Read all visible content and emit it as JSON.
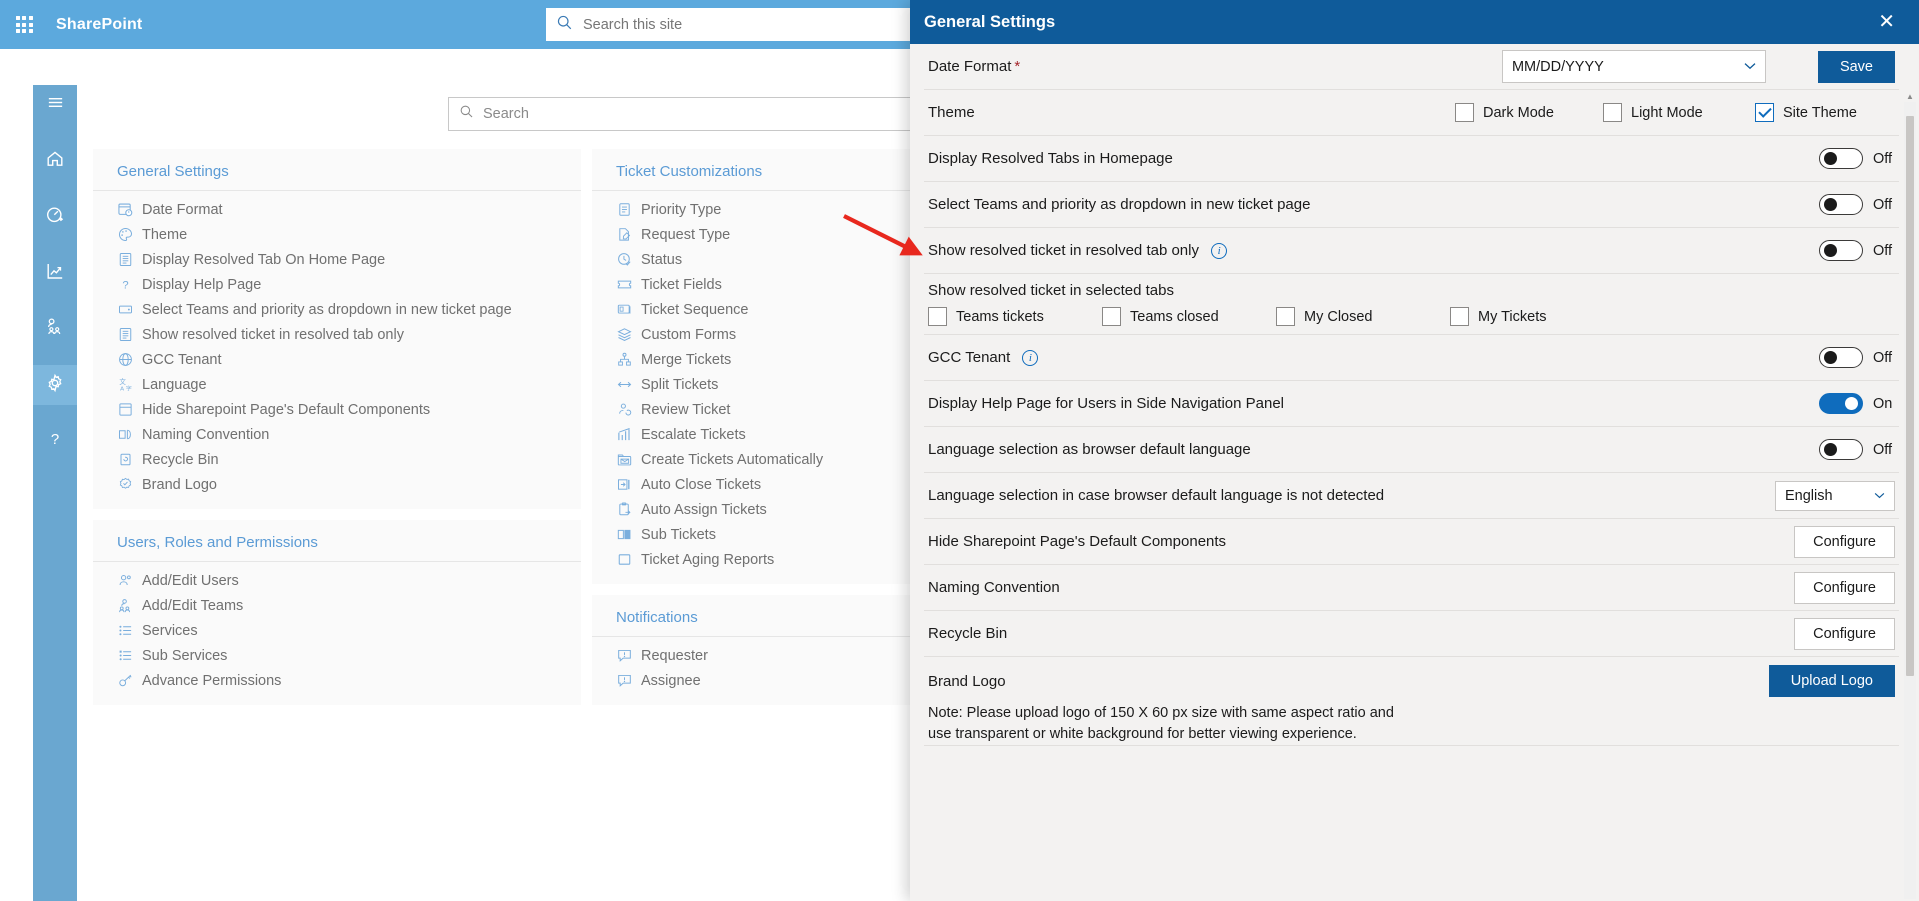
{
  "suite": {
    "title": "SharePoint",
    "waffle_icon": "app-launcher-icon",
    "search_placeholder": "Search this site",
    "search_value": "",
    "search_icon": "search-icon"
  },
  "app": {
    "search_placeholder": "Search",
    "search_value": "",
    "search_icon": "search-icon"
  },
  "rail": {
    "items": [
      {
        "name": "hamburger-menu",
        "icon": "hamburger-icon",
        "active": false
      },
      {
        "name": "home",
        "icon": "home-icon",
        "active": false
      },
      {
        "name": "dashboard",
        "icon": "gauge-icon",
        "active": false
      },
      {
        "name": "reports",
        "icon": "chart-line-icon",
        "active": false
      },
      {
        "name": "teams",
        "icon": "people-team-icon",
        "active": false
      },
      {
        "name": "settings",
        "icon": "gear-icon",
        "active": true
      },
      {
        "name": "help",
        "icon": "question-icon",
        "active": false
      }
    ]
  },
  "cards": [
    {
      "id": "general-settings",
      "title": "General Settings",
      "items": [
        {
          "label": "Date Format",
          "icon": "calendar-clock-icon"
        },
        {
          "label": "Theme",
          "icon": "palette-icon"
        },
        {
          "label": "Display Resolved Tab On Home Page",
          "icon": "list-icon"
        },
        {
          "label": "Display Help Page",
          "icon": "question-icon"
        },
        {
          "label": "Select Teams and priority as dropdown in new ticket page",
          "icon": "dropdown-icon"
        },
        {
          "label": "Show resolved ticket in resolved tab only",
          "icon": "list-icon"
        },
        {
          "label": "GCC Tenant",
          "icon": "globe-icon"
        },
        {
          "label": "Language",
          "icon": "translate-icon"
        },
        {
          "label": "Hide Sharepoint Page's Default Components",
          "icon": "page-icon"
        },
        {
          "label": "Naming Convention",
          "icon": "rename-icon"
        },
        {
          "label": "Recycle Bin",
          "icon": "recycle-bin-icon"
        },
        {
          "label": "Brand Logo",
          "icon": "badge-icon"
        }
      ]
    },
    {
      "id": "users-roles-permissions",
      "title": "Users, Roles and Permissions",
      "items": [
        {
          "label": "Add/Edit Users",
          "icon": "people-icon"
        },
        {
          "label": "Add/Edit Teams",
          "icon": "people-team-icon"
        },
        {
          "label": "Services",
          "icon": "bullet-list-icon"
        },
        {
          "label": "Sub Services",
          "icon": "sub-list-icon"
        },
        {
          "label": "Advance Permissions",
          "icon": "key-icon"
        }
      ]
    },
    {
      "id": "ticket-customizations",
      "title": "Ticket Customizations",
      "items": [
        {
          "label": "Priority Type",
          "icon": "clipboard-check-icon"
        },
        {
          "label": "Request Type",
          "icon": "document-edit-icon"
        },
        {
          "label": "Status",
          "icon": "clock-check-icon"
        },
        {
          "label": "Ticket Fields",
          "icon": "ticket-icon"
        },
        {
          "label": "Ticket Sequence",
          "icon": "number-sequence-icon"
        },
        {
          "label": "Custom Forms",
          "icon": "layers-icon"
        },
        {
          "label": "Merge Tickets",
          "icon": "merge-icon"
        },
        {
          "label": "Split Tickets",
          "icon": "split-arrows-icon"
        },
        {
          "label": "Review Ticket",
          "icon": "person-sync-icon"
        },
        {
          "label": "Escalate Tickets",
          "icon": "chart-up-icon"
        },
        {
          "label": "Create Tickets Automatically",
          "icon": "mail-folder-icon"
        },
        {
          "label": "Auto Close Tickets",
          "icon": "arrow-box-icon"
        },
        {
          "label": "Auto Assign Tickets",
          "icon": "clipboard-arrow-icon"
        },
        {
          "label": "Sub Tickets",
          "icon": "columns-icon"
        },
        {
          "label": "Ticket Aging Reports",
          "icon": "square-icon"
        }
      ]
    },
    {
      "id": "notifications",
      "title": "Notifications",
      "items": [
        {
          "label": "Requester",
          "icon": "comment-alert-icon"
        },
        {
          "label": "Assignee",
          "icon": "comment-alert-icon"
        }
      ]
    }
  ],
  "panel": {
    "title": "General Settings",
    "close_label": "✕",
    "save_label": "Save",
    "scrollbar_up": "▲",
    "rows": {
      "date_format": {
        "label": "Date Format",
        "required_marker": "*",
        "value": "MM/DD/YYYY",
        "chevron": "⌄"
      },
      "theme": {
        "label": "Theme",
        "options": [
          {
            "label": "Dark Mode",
            "checked": false
          },
          {
            "label": "Light Mode",
            "checked": false
          },
          {
            "label": "Site Theme",
            "checked": true
          }
        ]
      },
      "display_resolved_tabs": {
        "label": "Display Resolved Tabs in Homepage",
        "state": "Off",
        "on": false
      },
      "select_teams_priority": {
        "label": "Select Teams and priority as dropdown in new ticket page",
        "state": "Off",
        "on": false
      },
      "show_resolved_only": {
        "label": "Show resolved ticket in resolved tab only",
        "info_icon": "info-icon",
        "state": "Off",
        "on": false
      },
      "show_resolved_selected_tabs": {
        "label": "Show resolved ticket in selected tabs",
        "options": [
          {
            "label": "Teams tickets",
            "checked": false
          },
          {
            "label": "Teams closed",
            "checked": false
          },
          {
            "label": "My Closed",
            "checked": false
          },
          {
            "label": "My Tickets",
            "checked": false
          }
        ]
      },
      "gcc_tenant": {
        "label": "GCC Tenant",
        "info_icon": "info-icon",
        "state": "Off",
        "on": false
      },
      "display_help_page": {
        "label": "Display Help Page for Users in Side Navigation Panel",
        "state": "On",
        "on": true
      },
      "language_browser_default": {
        "label": "Language selection as browser default language",
        "state": "Off",
        "on": false
      },
      "language_fallback": {
        "label": "Language selection in case browser default language is not detected",
        "value": "English",
        "chevron": "⌄"
      },
      "hide_sp_components": {
        "label": "Hide Sharepoint Page's Default Components",
        "button": "Configure"
      },
      "naming_convention": {
        "label": "Naming Convention",
        "button": "Configure"
      },
      "recycle_bin": {
        "label": "Recycle Bin",
        "button": "Configure"
      },
      "brand_logo": {
        "label": "Brand Logo",
        "button": "Upload Logo",
        "note": "Note: Please upload logo of 150 X 60 px size with same aspect ratio and use transparent or white background for better viewing experience."
      }
    }
  },
  "annotation": {
    "arrow_color": "#e8281e",
    "name": "red-pointer-arrow"
  },
  "colors": {
    "suite_bar": "#5ca9dd",
    "rail": "#6aa7d0",
    "panel_header": "#0f5b9a",
    "accent": "#0f6cbd",
    "card_title": "#5b9bd5",
    "required": "#a4262c"
  }
}
